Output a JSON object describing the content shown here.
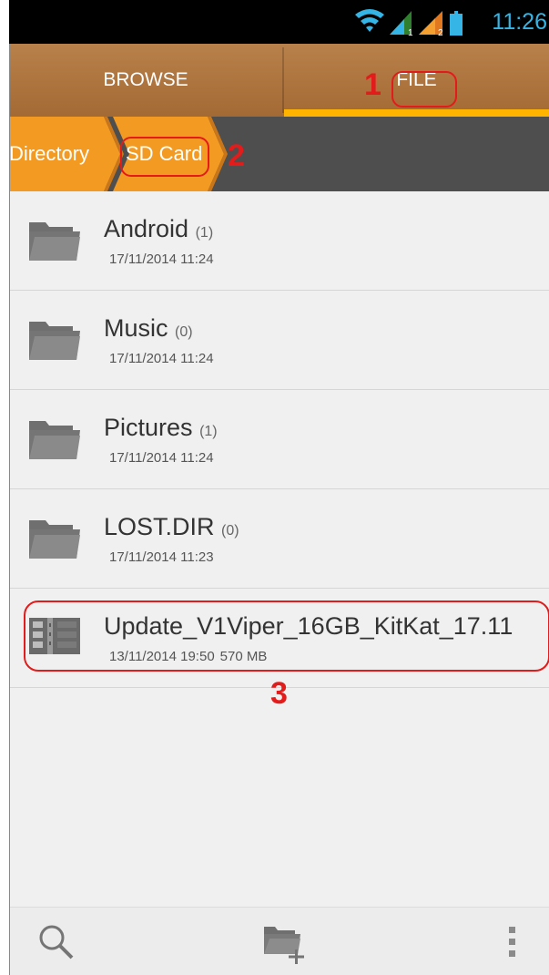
{
  "status_bar": {
    "time": "11:26"
  },
  "tabs": [
    {
      "label": "BROWSE"
    },
    {
      "label": "FILE"
    }
  ],
  "breadcrumb": [
    {
      "label": "Directory"
    },
    {
      "label": "SD Card"
    }
  ],
  "files": [
    {
      "name": "Android",
      "count": "(1)",
      "date": "17/11/2014 11:24",
      "size": "",
      "icon": "folder-icon"
    },
    {
      "name": "Music",
      "count": "(0)",
      "date": "17/11/2014 11:24",
      "size": "",
      "icon": "folder-icon"
    },
    {
      "name": "Pictures",
      "count": "(1)",
      "date": "17/11/2014 11:24",
      "size": "",
      "icon": "folder-icon"
    },
    {
      "name": "LOST.DIR",
      "count": "(0)",
      "date": "17/11/2014 11:23",
      "size": "",
      "icon": "folder-icon"
    },
    {
      "name": "Update_V1Viper_16GB_KitKat_17.11",
      "count": "",
      "date": "13/11/2014 19:50",
      "size": "570 MB",
      "icon": "archive-file-icon"
    }
  ],
  "annotations": [
    "1",
    "2",
    "3"
  ],
  "bottom_bar": [
    "search-icon",
    "new-folder-icon",
    "overflow-menu-icon"
  ],
  "colors": {
    "accent": "#ffb400",
    "tab_bg": "#a46a35",
    "breadcrumb_bg": "#4e4e4e",
    "crumb_orange": "#f39a23",
    "annotation": "#e31b1b",
    "status_blue": "#34b5e5"
  }
}
